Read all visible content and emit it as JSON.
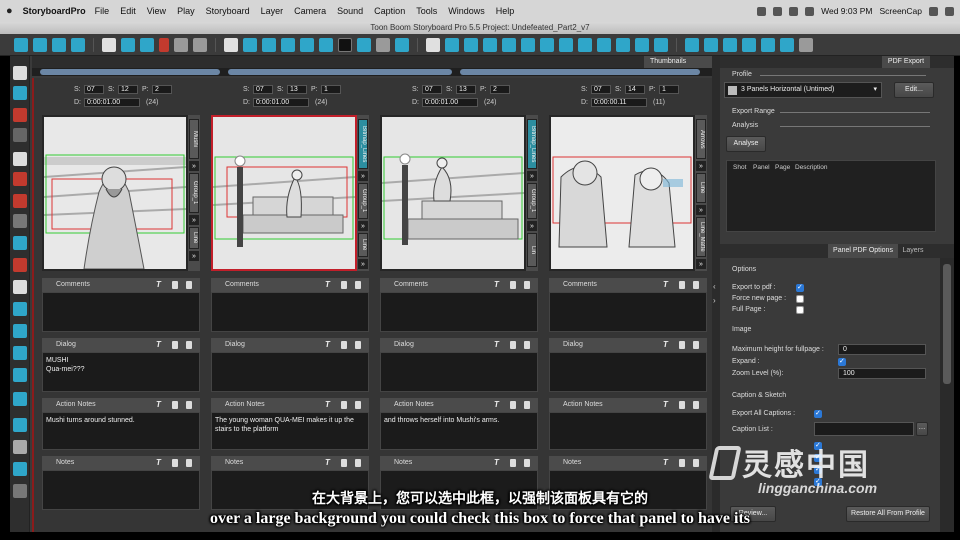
{
  "menubar": {
    "app": "StoryboardPro",
    "items": [
      "File",
      "Edit",
      "View",
      "Play",
      "Storyboard",
      "Layer",
      "Camera",
      "Sound",
      "Caption",
      "Tools",
      "Windows",
      "Help"
    ],
    "clock": "Wed 9:03 PM",
    "right_app": "ScreenCap"
  },
  "window": {
    "title": "Toon Boom Storyboard Pro 5.5 Project: Undefeated_Part2_v7"
  },
  "thumbnails": {
    "tab_label": "Thumbnails"
  },
  "panels": [
    {
      "s": "07",
      "sp": "12",
      "p": "2",
      "d": "0:00:01.00",
      "frames": "(24)",
      "selected": false,
      "layers": [
        "Mushi",
        "Group_1",
        "Line"
      ],
      "dialog": "MUSHI\nQua-mei???",
      "action": "Mushi turns around stunned."
    },
    {
      "s": "07",
      "sp": "13",
      "p": "1",
      "d": "0:00:01.00",
      "frames": "(24)",
      "selected": true,
      "layers": [
        "Bitmap_Lines",
        "Group_1",
        "Line"
      ],
      "dialog": "",
      "action": "The young woman QUA-MEI makes it up the stairs to the platform"
    },
    {
      "s": "07",
      "sp": "13",
      "p": "2",
      "d": "0:00:01.00",
      "frames": "(24)",
      "selected": false,
      "layers": [
        "Bitmap_Lines",
        "Group_1",
        "Lin"
      ],
      "dialog": "",
      "action": "and throws herself into Mushi's arms."
    },
    {
      "s": "07",
      "sp": "14",
      "p": "1",
      "d": "0:00:00.11",
      "frames": "(11)",
      "selected": false,
      "layers": [
        "Arrows",
        "Line",
        "Line_Matte"
      ],
      "dialog": "",
      "action": ""
    }
  ],
  "panel_labels": {
    "s": "S:",
    "sp": "P:",
    "d": "D:",
    "comments": "Comments",
    "dialog": "Dialog",
    "action": "Action Notes",
    "notes": "Notes"
  },
  "pdf_export": {
    "tab_label": "PDF Export",
    "profile_label": "Profile",
    "profile_value": "3 Panels Horizontal (Untimed)",
    "edit_button": "Edit...",
    "export_range_label": "Export Range",
    "analysis_label": "Analysis",
    "analyse_button": "Analyse",
    "table_headers": [
      "Shot",
      "Panel",
      "Page",
      "Description"
    ]
  },
  "panel_pdf_options": {
    "tab_label": "Panel PDF Options",
    "layers_tab": "Layers",
    "options_label": "Options",
    "export_to_pdf": "Export to pdf :",
    "force_new_page": "Force new page :",
    "full_page": "Full Page :",
    "image_label": "Image",
    "max_height_label": "Maximum height for fullpage :",
    "max_height_value": "0",
    "expand_label": "Expand :",
    "zoom_label": "Zoom Level (%):",
    "zoom_value": "100",
    "caption_sketch_label": "Caption & Sketch",
    "export_all_captions": "Export All Captions :",
    "caption_list": "Caption List :",
    "review_button": "Review...",
    "restore_button": "Restore All From Profile"
  },
  "watermark": {
    "cn": "灵感中国",
    "en": "lingganchina.com"
  },
  "subtitles": {
    "cn": "在大背景上，您可以选中此框，以强制该面板具有它的",
    "en": "over a large background you could check this box to force that panel to have its"
  },
  "colors": {
    "accent": "#2fa6c9",
    "selection": "#c21f2a",
    "checkbox": "#2b78d6"
  }
}
